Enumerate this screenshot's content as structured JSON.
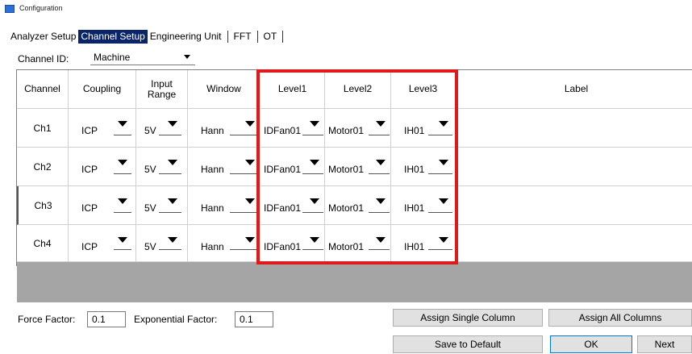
{
  "window": {
    "title": "Configuration",
    "icon": "app-window-icon"
  },
  "tabs": [
    {
      "label": "Analyzer Setup",
      "active": false
    },
    {
      "label": "Channel Setup",
      "active": true
    },
    {
      "label": "Engineering Unit",
      "active": false
    },
    {
      "label": "FFT",
      "active": false
    },
    {
      "label": "OT",
      "active": false
    }
  ],
  "channel_id": {
    "label": "Channel ID:",
    "value": "Machine"
  },
  "grid": {
    "headers": {
      "channel": "Channel",
      "coupling": "Coupling",
      "input_range": "Input\nRange",
      "window": "Window",
      "level1": "Level1",
      "level2": "Level2",
      "level3": "Level3",
      "label": "Label"
    },
    "rows": [
      {
        "channel": "Ch1",
        "coupling": "ICP",
        "input_range": "5V",
        "window": "Hann",
        "level1": "IDFan01",
        "level2": "Motor01",
        "level3": "IH01",
        "label": ""
      },
      {
        "channel": "Ch2",
        "coupling": "ICP",
        "input_range": "5V",
        "window": "Hann",
        "level1": "IDFan01",
        "level2": "Motor01",
        "level3": "IH01",
        "label": ""
      },
      {
        "channel": "Ch3",
        "coupling": "ICP",
        "input_range": "5V",
        "window": "Hann",
        "level1": "IDFan01",
        "level2": "Motor01",
        "level3": "IH01",
        "label": ""
      },
      {
        "channel": "Ch4",
        "coupling": "ICP",
        "input_range": "5V",
        "window": "Hann",
        "level1": "IDFan01",
        "level2": "Motor01",
        "level3": "IH01",
        "label": ""
      }
    ]
  },
  "highlight_color": "#e0191b",
  "force_factor": {
    "label": "Force Factor:",
    "value": "0.1"
  },
  "exponential_factor": {
    "label": "Exponential Factor:",
    "value": "0.1"
  },
  "buttons": {
    "assign_single": "Assign Single Column",
    "assign_all": "Assign All Columns",
    "save_default": "Save to Default",
    "ok": "OK",
    "next": "Next"
  }
}
